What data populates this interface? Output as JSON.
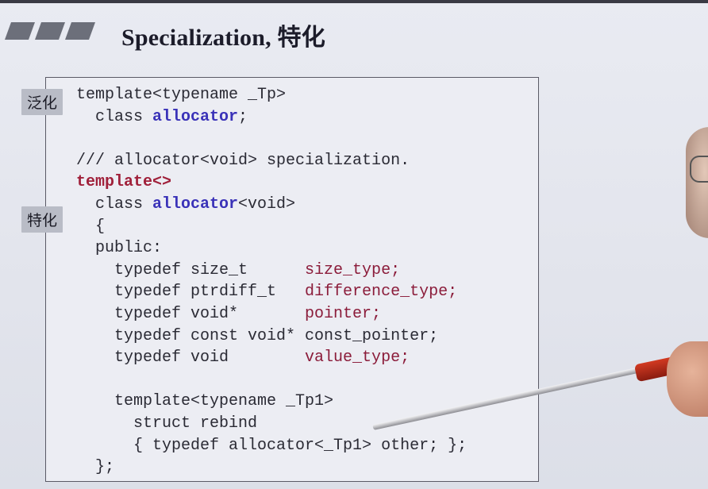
{
  "slide": {
    "title": "Specialization, 特化",
    "label_generic": "泛化",
    "label_special": "特化"
  },
  "code": {
    "lines": [
      [
        {
          "t": "template<typename _Tp>",
          "c": "plain"
        }
      ],
      [
        {
          "t": "  class ",
          "c": "plain"
        },
        {
          "t": "allocator",
          "c": "blue"
        },
        {
          "t": ";",
          "c": "plain"
        }
      ],
      [
        {
          "t": "",
          "c": "plain"
        }
      ],
      [
        {
          "t": "/// allocator<void> specialization.",
          "c": "plain"
        }
      ],
      [
        {
          "t": "template<>",
          "c": "red"
        }
      ],
      [
        {
          "t": "  class ",
          "c": "plain"
        },
        {
          "t": "allocator",
          "c": "blue"
        },
        {
          "t": "<void>",
          "c": "plain"
        }
      ],
      [
        {
          "t": "  {",
          "c": "plain"
        }
      ],
      [
        {
          "t": "  public:",
          "c": "plain"
        }
      ],
      [
        {
          "t": "    typedef size_t      ",
          "c": "plain"
        },
        {
          "t": "size_type;",
          "c": "type"
        }
      ],
      [
        {
          "t": "    typedef ptrdiff_t   ",
          "c": "plain"
        },
        {
          "t": "difference_type;",
          "c": "type"
        }
      ],
      [
        {
          "t": "    typedef void*       ",
          "c": "plain"
        },
        {
          "t": "pointer;",
          "c": "type"
        }
      ],
      [
        {
          "t": "    typedef const void* ",
          "c": "plain"
        },
        {
          "t": "const_pointer;",
          "c": "plain"
        }
      ],
      [
        {
          "t": "    typedef void        ",
          "c": "plain"
        },
        {
          "t": "value_type;",
          "c": "type"
        }
      ],
      [
        {
          "t": "",
          "c": "plain"
        }
      ],
      [
        {
          "t": "    template<typename _Tp1>",
          "c": "plain"
        }
      ],
      [
        {
          "t": "      struct rebind",
          "c": "plain"
        }
      ],
      [
        {
          "t": "      { typedef allocator<_Tp1> other; };",
          "c": "plain"
        }
      ],
      [
        {
          "t": "  };",
          "c": "plain"
        }
      ]
    ]
  },
  "colors": {
    "keyword_blue": "#3a32b8",
    "keyword_red": "#a0203a",
    "type_name": "#8b1c3a",
    "stripe": "#6c6f7a"
  }
}
